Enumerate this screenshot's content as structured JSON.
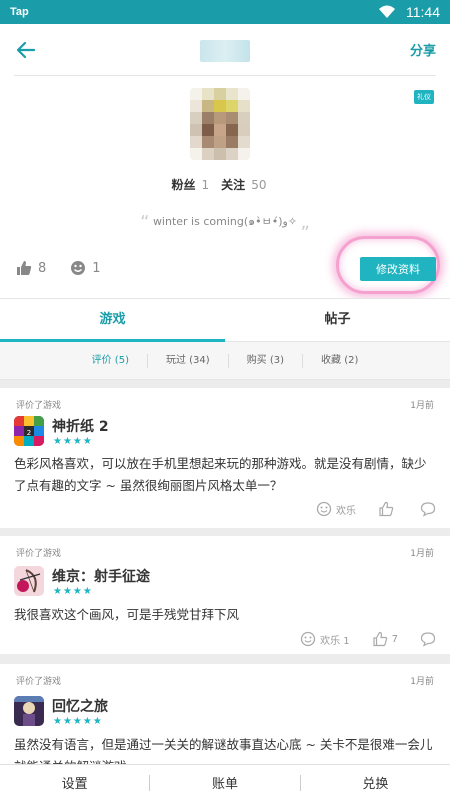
{
  "status_bar": {
    "carrier": "Tap",
    "time": "11:44"
  },
  "header": {
    "share_label": "分享"
  },
  "profile": {
    "badge": "礼仪",
    "fans_label": "粉丝",
    "fans_count": "1",
    "follow_label": "关注",
    "follow_count": "50",
    "motto": "winter is coming(๑•̀ㅂ•́)و✧",
    "likes": "8",
    "smiles": "1",
    "edit_button": "修改资料"
  },
  "tabs": [
    {
      "label": "游戏",
      "active": true
    },
    {
      "label": "帖子",
      "active": false
    }
  ],
  "subtabs": [
    {
      "label": "评价 (5)",
      "active": true
    },
    {
      "label": "玩过 (34)",
      "active": false
    },
    {
      "label": "购买 (3)",
      "active": false
    },
    {
      "label": "收藏 (2)",
      "active": false
    }
  ],
  "reviews": [
    {
      "meta": "评价了游戏",
      "time": "1月前",
      "game": "神折纸 2",
      "rating": 4,
      "stars": "★★★★",
      "text": "色彩风格喜欢，可以放在手机里想起来玩的那种游戏。就是没有剧情，缺少了点有趣的文字 ~ 虽然很绚丽图片风格太单一？",
      "happy_label": "欢乐",
      "like_count": "",
      "icon": "origami-game-icon"
    },
    {
      "meta": "评价了游戏",
      "time": "1月前",
      "game": "维京：射手征途",
      "rating": 4,
      "stars": "★★★★",
      "text": "我很喜欢这个画风，可是手残党甘拜下风",
      "happy_label": "欢乐 1",
      "like_count": "7",
      "icon": "archer-game-icon"
    },
    {
      "meta": "评价了游戏",
      "time": "1月前",
      "game": "回忆之旅",
      "rating": 5,
      "stars": "★★★★★",
      "text": "虽然没有语言，但是通过一关关的解谜故事直达心底 ~ 关卡不是很难一会儿就能通关的解谜游戏",
      "happy_label": "",
      "like_count": "",
      "icon": "memory-game-icon"
    }
  ],
  "bottom_bar": {
    "settings": "设置",
    "bill": "账单",
    "exchange": "兑换"
  },
  "colors": {
    "accent": "#1fb4c0",
    "status_bar": "#1a9da8",
    "highlight_ring": "#ec54a8"
  }
}
